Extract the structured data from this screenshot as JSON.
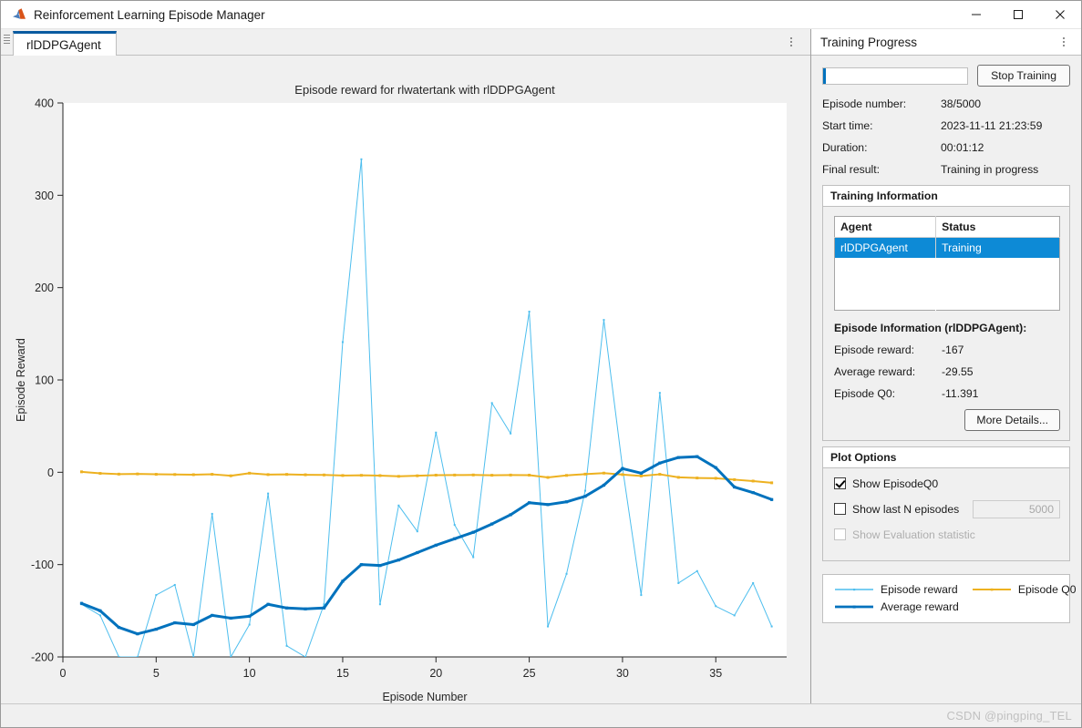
{
  "window": {
    "title": "Reinforcement Learning Episode Manager",
    "icon": "matlab-icon",
    "minimize": "—",
    "maximize": "☐",
    "close": "✕"
  },
  "tabbar": {
    "tabs": [
      {
        "label": "rlDDPGAgent"
      }
    ],
    "overflow_menu": "more-options"
  },
  "right_panel": {
    "header_title": "Training Progress",
    "overflow_menu": "more-options",
    "stop_button": "Stop Training",
    "progress_percent": 1,
    "fields": [
      {
        "label": "Episode number:",
        "value": "38/5000"
      },
      {
        "label": "Start time:",
        "value": "2023-11-11 21:23:59"
      },
      {
        "label": "Duration:",
        "value": "00:01:12"
      },
      {
        "label": "Final result:",
        "value": "Training in progress"
      }
    ],
    "training_information": {
      "title": "Training Information",
      "columns": [
        "Agent",
        "Status"
      ],
      "rows": [
        {
          "agent": "rlDDPGAgent",
          "status": "Training",
          "selected": true
        }
      ],
      "episode_information_title": "Episode Information (rlDDPGAgent):",
      "episode_fields": [
        {
          "label": "Episode reward:",
          "value": "-167"
        },
        {
          "label": "Average reward:",
          "value": "-29.55"
        },
        {
          "label": "Episode Q0:",
          "value": "-11.391"
        }
      ],
      "more_details_button": "More Details..."
    },
    "plot_options": {
      "title": "Plot Options",
      "options": [
        {
          "label": "Show EpisodeQ0",
          "checked": true,
          "disabled": false
        },
        {
          "label": "Show last N episodes",
          "checked": false,
          "disabled": false,
          "field_value": "5000"
        },
        {
          "label": "Show Evaluation statistic",
          "checked": false,
          "disabled": true
        }
      ]
    },
    "legend": [
      {
        "label": "Episode reward",
        "color": "#4dbeee",
        "width": 1
      },
      {
        "label": "Episode Q0",
        "color": "#edb120",
        "width": 2
      },
      {
        "label": "Average reward",
        "color": "#0072bd",
        "width": 3
      }
    ]
  },
  "statusbar": {
    "watermark": "CSDN @pingping_TEL"
  },
  "chart_data": {
    "type": "line",
    "title": "Episode reward for rlwatertank with rlDDPGAgent",
    "xlabel": "Episode Number",
    "ylabel": "Episode Reward",
    "xlim": [
      0,
      38.8
    ],
    "ylim": [
      -200,
      400
    ],
    "xticks": [
      0,
      5,
      10,
      15,
      20,
      25,
      30,
      35
    ],
    "yticks": [
      -200,
      -100,
      0,
      100,
      200,
      300,
      400
    ],
    "grid": false,
    "legend_position": "external-right-panel",
    "x": [
      1,
      2,
      3,
      4,
      5,
      6,
      7,
      8,
      9,
      10,
      11,
      12,
      13,
      14,
      15,
      16,
      17,
      18,
      19,
      20,
      21,
      22,
      23,
      24,
      25,
      26,
      27,
      28,
      29,
      30,
      31,
      32,
      33,
      34,
      35,
      36,
      37,
      38
    ],
    "series": [
      {
        "name": "Episode reward",
        "color": "#4dbeee",
        "width": 1,
        "values": [
          -143,
          -155,
          -200,
          -200,
          -133,
          -122,
          -200,
          -45,
          -200,
          -165,
          -23,
          -188,
          -200,
          -143,
          141,
          339,
          -143,
          -36,
          -64,
          43,
          -57,
          -92,
          75,
          42,
          174,
          -167,
          -110,
          -20,
          165,
          5,
          -133,
          86,
          -120,
          -107,
          -145,
          -155,
          -120,
          -167
        ]
      },
      {
        "name": "Episode Q0",
        "color": "#edb120",
        "width": 2,
        "values": [
          0.5,
          -1.2,
          -2.0,
          -1.8,
          -2.2,
          -2.4,
          -2.6,
          -2.2,
          -3.8,
          -1.0,
          -2.5,
          -2.3,
          -2.7,
          -2.9,
          -3.5,
          -3.3,
          -3.6,
          -4.4,
          -3.8,
          -3.1,
          -3.0,
          -2.9,
          -3.2,
          -3.0,
          -3.1,
          -5.6,
          -3.4,
          -2.0,
          -0.9,
          -2.5,
          -4.0,
          -2.2,
          -5.5,
          -6.2,
          -6.5,
          -8.0,
          -9.5,
          -11.391
        ]
      },
      {
        "name": "Average reward",
        "color": "#0072bd",
        "width": 3,
        "values": [
          -142,
          -150,
          -168,
          -175,
          -170,
          -163,
          -165,
          -155,
          -158,
          -156,
          -143,
          -147,
          -148,
          -147,
          -118,
          -100,
          -101,
          -95,
          -87,
          -79,
          -72,
          -65,
          -56,
          -46,
          -33,
          -35,
          -32,
          -26,
          -14,
          4,
          -1,
          10,
          16,
          17,
          5,
          -16,
          -22,
          -29.55
        ]
      }
    ]
  }
}
